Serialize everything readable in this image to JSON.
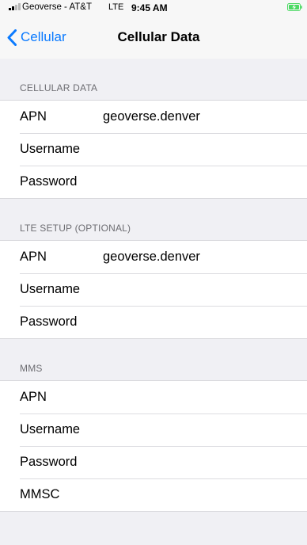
{
  "status_bar": {
    "carrier": "Geoverse - AT&T",
    "network": "LTE",
    "time": "9:45 AM",
    "battery_color": "#4cd964"
  },
  "nav": {
    "back_label": "Cellular",
    "title": "Cellular Data",
    "accent_color": "#0a7aff"
  },
  "sections": [
    {
      "header": "CELLULAR DATA",
      "rows": [
        {
          "label": "APN",
          "value": "geoverse.denver"
        },
        {
          "label": "Username",
          "value": ""
        },
        {
          "label": "Password",
          "value": ""
        }
      ]
    },
    {
      "header": "LTE SETUP (OPTIONAL)",
      "rows": [
        {
          "label": "APN",
          "value": "geoverse.denver"
        },
        {
          "label": "Username",
          "value": ""
        },
        {
          "label": "Password",
          "value": ""
        }
      ]
    },
    {
      "header": "MMS",
      "rows": [
        {
          "label": "APN",
          "value": ""
        },
        {
          "label": "Username",
          "value": ""
        },
        {
          "label": "Password",
          "value": ""
        },
        {
          "label": "MMSC",
          "value": ""
        }
      ]
    }
  ]
}
